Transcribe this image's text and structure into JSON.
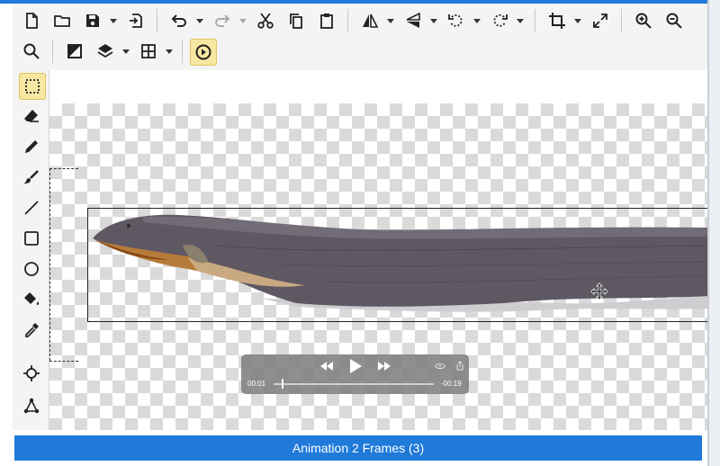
{
  "toolbar": {
    "row1": [
      "new-file-icon",
      "open-folder-icon",
      "save-icon",
      "export-icon",
      "undo-icon",
      "redo-icon",
      "cut-icon",
      "copy-icon",
      "paste-icon",
      "flip-horizontal-icon",
      "flip-vertical-icon",
      "rotate-ccw-icon",
      "rotate-cw-icon",
      "crop-icon",
      "resize-icon",
      "zoom-in-icon",
      "zoom-out-icon"
    ],
    "row2": [
      "zoom-reset-icon",
      "invert-icon",
      "layers-icon",
      "grid-icon",
      "animation-play-icon"
    ]
  },
  "left_tools": [
    "rect-select-icon",
    "eraser-icon",
    "pencil-icon",
    "brush-icon",
    "line-icon",
    "rectangle-icon",
    "ellipse-icon",
    "fill-bucket-icon",
    "eyedropper-icon",
    "crosshair-icon",
    "node-icon"
  ],
  "video_player": {
    "current_time": "00:01",
    "remaining_time": "-00:19",
    "progress": 0.05
  },
  "panel": {
    "title": "Animation 2 Frames (3)"
  },
  "colors": {
    "accent": "#1f7ad9",
    "active_tool": "#f6e7a2",
    "eel_body": "#5e5863"
  }
}
